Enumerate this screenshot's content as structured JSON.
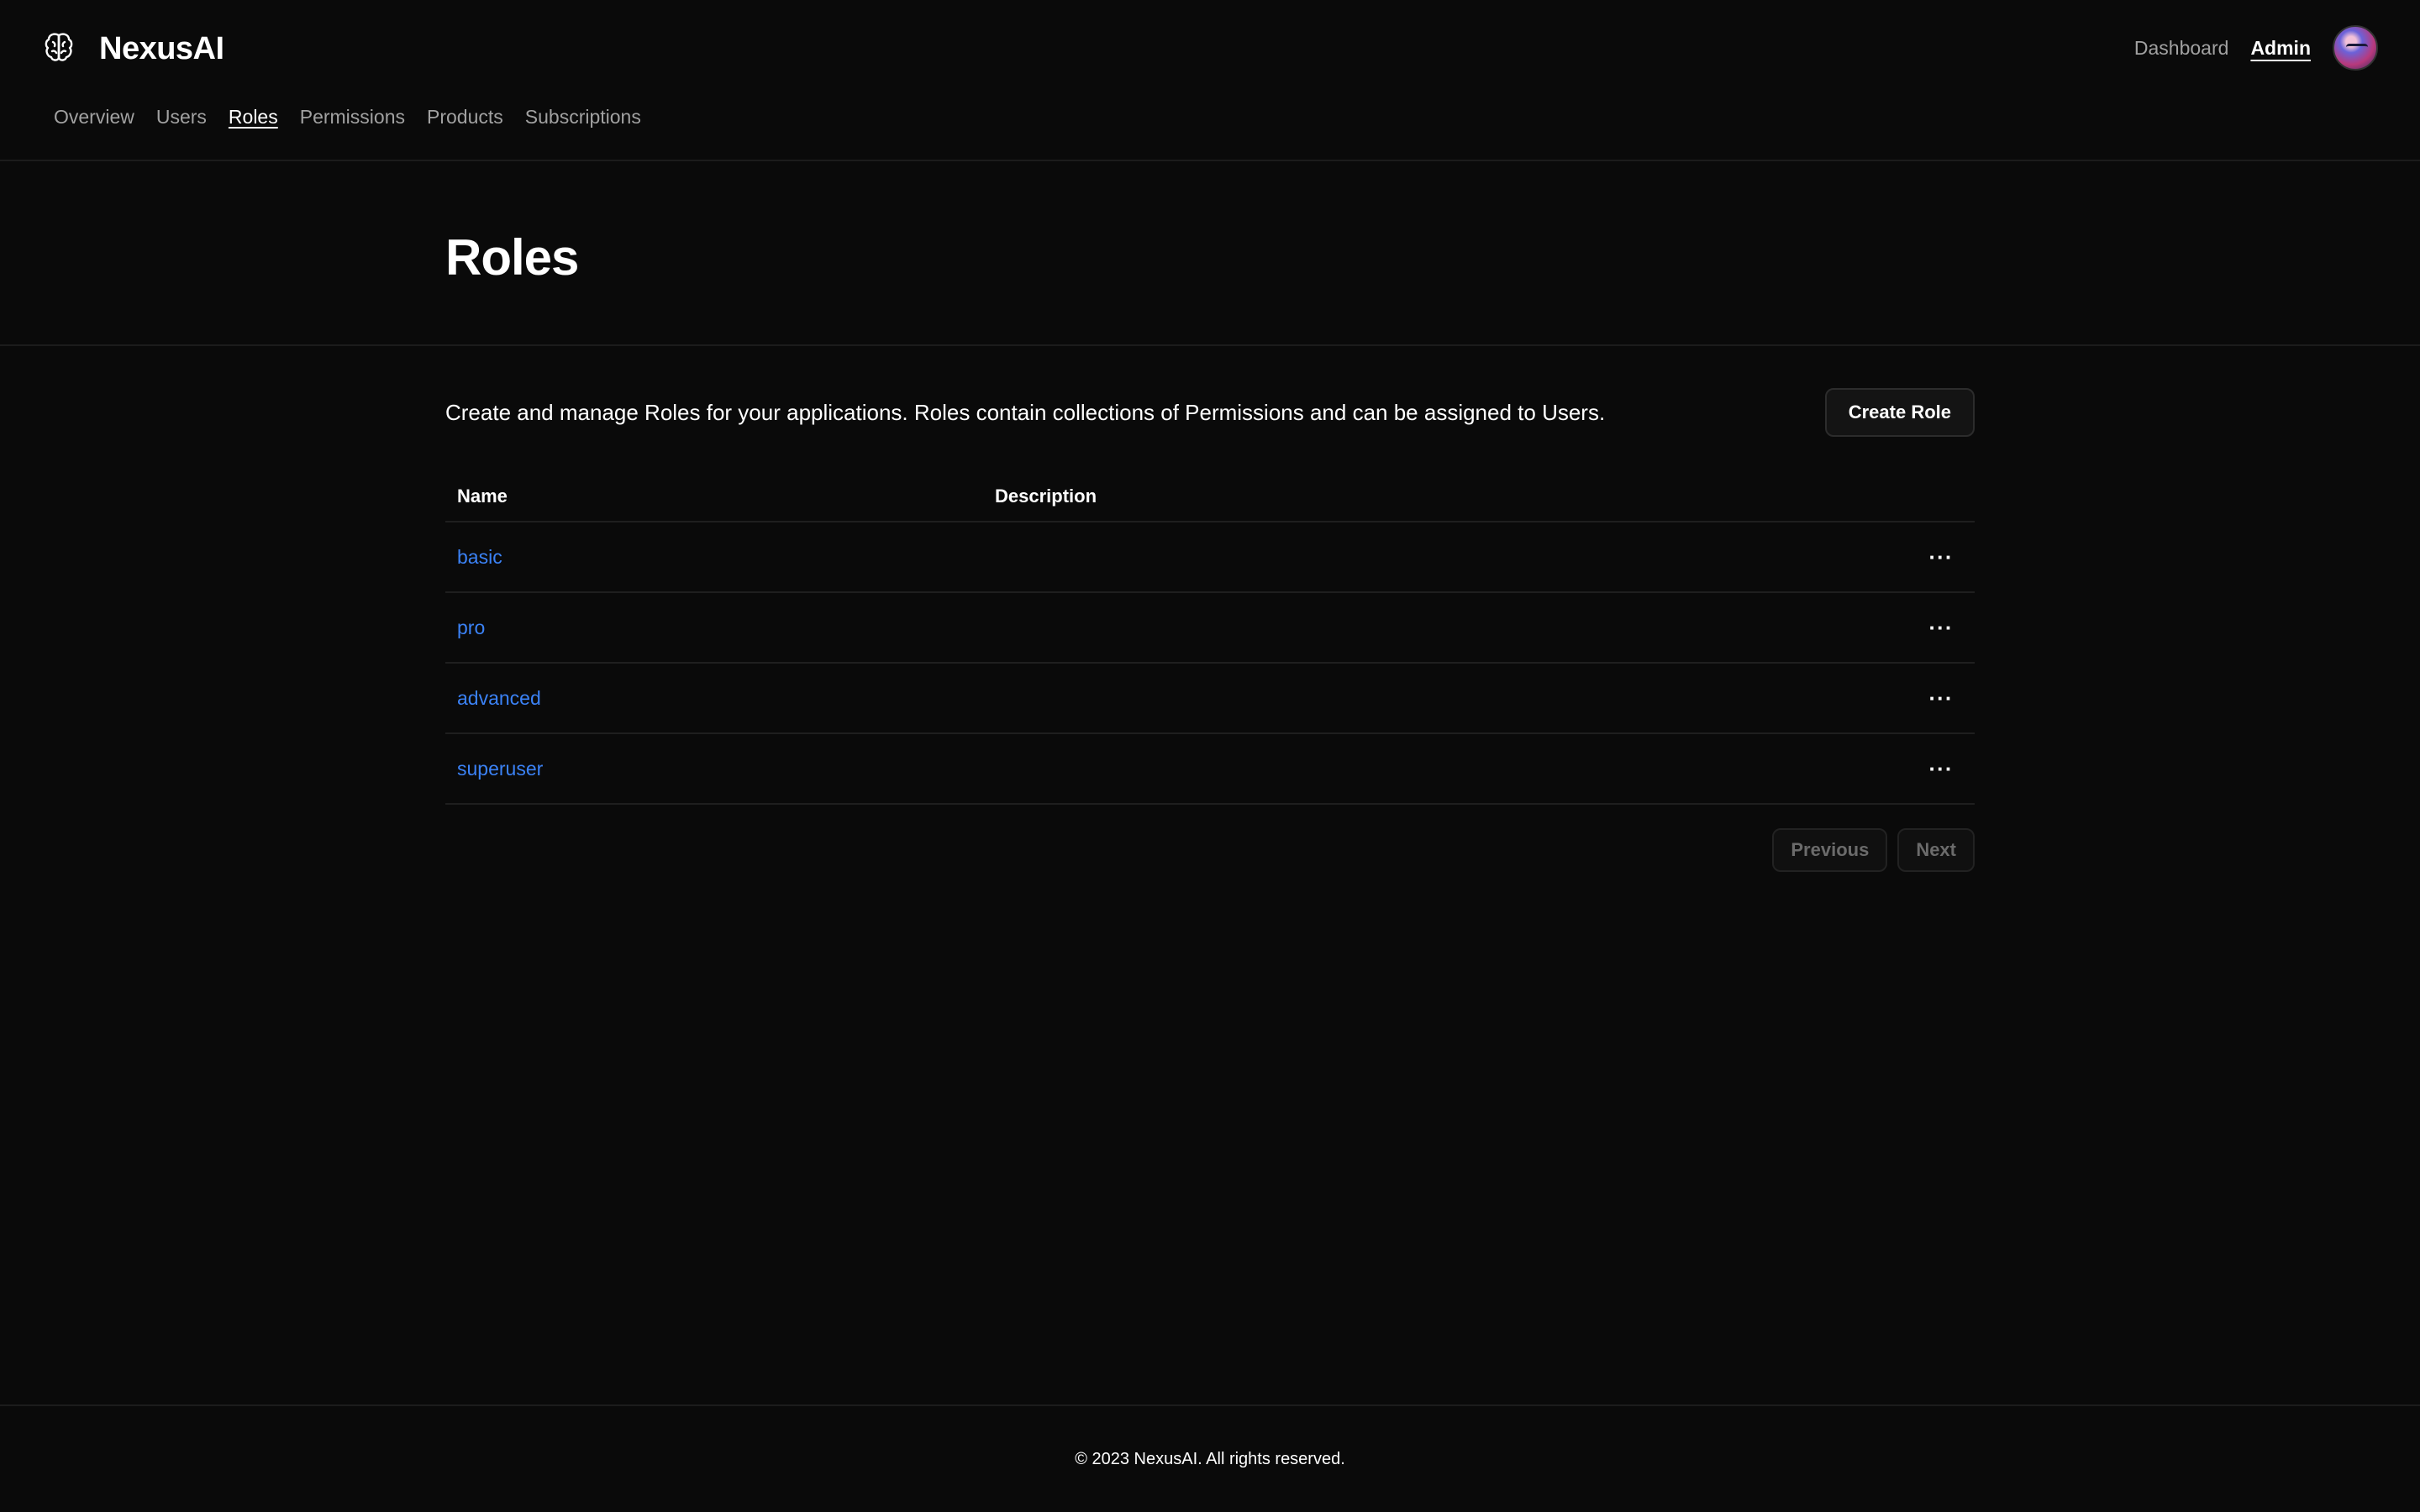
{
  "brand": {
    "name": "NexusAI",
    "icon": "brain-icon"
  },
  "tabs": [
    {
      "label": "Overview",
      "active": false
    },
    {
      "label": "Users",
      "active": false
    },
    {
      "label": "Roles",
      "active": true
    },
    {
      "label": "Permissions",
      "active": false
    },
    {
      "label": "Products",
      "active": false
    },
    {
      "label": "Subscriptions",
      "active": false
    }
  ],
  "topnav": {
    "dashboard": "Dashboard",
    "admin": "Admin"
  },
  "page": {
    "title": "Roles",
    "intro": "Create and manage Roles for your applications. Roles contain collections of Permissions and can be assigned to Users.",
    "create_label": "Create Role"
  },
  "table": {
    "headers": {
      "name": "Name",
      "description": "Description"
    },
    "rows": [
      {
        "name": "basic",
        "description": ""
      },
      {
        "name": "pro",
        "description": ""
      },
      {
        "name": "advanced",
        "description": ""
      },
      {
        "name": "superuser",
        "description": ""
      }
    ],
    "row_action_icon": "more-horizontal-icon"
  },
  "pager": {
    "previous": "Previous",
    "next": "Next"
  },
  "footer": {
    "text": "© 2023 NexusAI. All rights reserved."
  },
  "colors": {
    "background": "#0a0a0a",
    "link": "#3b82f6",
    "muted": "#a1a1a1"
  }
}
